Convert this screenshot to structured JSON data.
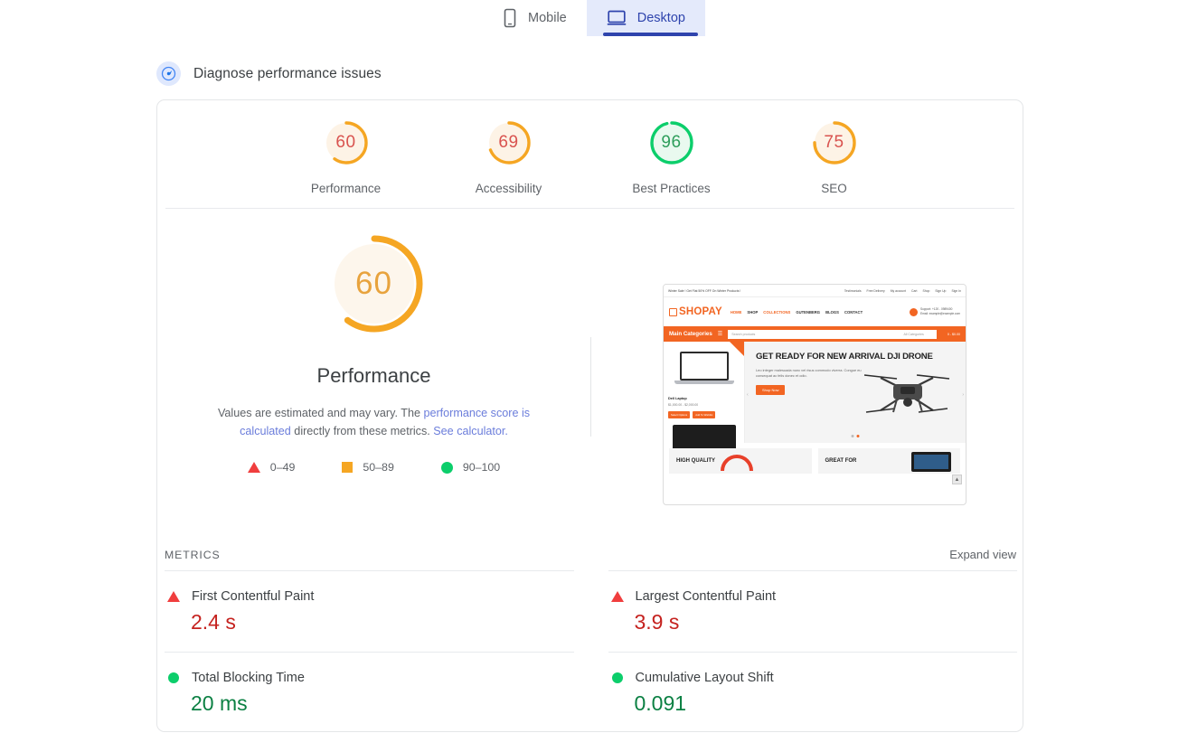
{
  "tabs": [
    {
      "label": "Mobile",
      "icon": "mobile-icon",
      "active": false
    },
    {
      "label": "Desktop",
      "icon": "desktop-icon",
      "active": true
    }
  ],
  "diagnose": {
    "label": "Diagnose performance issues",
    "icon": "speedometer-icon"
  },
  "categories": [
    {
      "label": "Performance",
      "score": 60,
      "color": "#f5a623",
      "fill": "#fef6ec",
      "text": "#d9534f"
    },
    {
      "label": "Accessibility",
      "score": 69,
      "color": "#f5a623",
      "fill": "#fef6ec",
      "text": "#d9534f"
    },
    {
      "label": "Best Practices",
      "score": 96,
      "color": "#0cce6b",
      "fill": "#e9f9ef",
      "text": "#2e9e5b"
    },
    {
      "label": "SEO",
      "score": 75,
      "color": "#f5a623",
      "fill": "#fef6ec",
      "text": "#d9534f"
    }
  ],
  "main_gauge": {
    "score": 60,
    "title": "Performance",
    "color": "#f5a623",
    "fill": "#fdf6ec",
    "desc_pre": "Values are estimated and may vary. The ",
    "desc_link1": "performance score is calculated",
    "desc_mid": " directly from these metrics. ",
    "desc_link2": "See calculator."
  },
  "legend": [
    {
      "shape": "triangle",
      "label": "0–49",
      "color": "#f03e3e"
    },
    {
      "shape": "square",
      "label": "50–89",
      "color": "#f5a623"
    },
    {
      "shape": "circle",
      "label": "90–100",
      "color": "#0cce6b"
    }
  ],
  "metrics_section": {
    "title": "METRICS",
    "expand": "Expand view"
  },
  "metrics": [
    {
      "name": "First Contentful Paint",
      "value": "2.4 s",
      "status": "fail",
      "icon": "warning-triangle-icon"
    },
    {
      "name": "Largest Contentful Paint",
      "value": "3.9 s",
      "status": "fail",
      "icon": "warning-triangle-icon"
    },
    {
      "name": "Total Blocking Time",
      "value": "20 ms",
      "status": "pass",
      "icon": "pass-circle-icon"
    },
    {
      "name": "Cumulative Layout Shift",
      "value": "0.091",
      "status": "pass",
      "icon": "pass-circle-icon"
    }
  ],
  "thumbnail": {
    "topbar_promo": "Winter Sale ! Get Flat 50% OFF On Winter Products !",
    "topbar_links": [
      "Testimonials",
      "Free Delivery",
      "My account",
      "Cart",
      "Shop",
      "Sign Up",
      "Sign In"
    ],
    "brand": "SHOPAY",
    "nav": [
      "HOME",
      "SHOP",
      "COLLECTIONS",
      "GUTENBERG",
      "BLOGS",
      "CONTACT"
    ],
    "support_line1": "Support: +120 - 0989400",
    "support_line2": "Email: example@example.com",
    "main_categories": "Main Categories",
    "search_placeholder": "Search products",
    "category_select": "All Categories",
    "cart_text": "0 - $0.00",
    "product_name": "Dell Laptop",
    "product_price": "$1,000.00 - $2,000.00",
    "product_btn1": "Select Options",
    "product_btn2": "Add To Wishlist",
    "hero_title": "GET READY FOR NEW ARRIVAL DJI DRONE",
    "hero_text": "Leo integer malesuada nunc vel risus commodo viverra. Congue eu consequat ac felis donec et odio.",
    "hero_button": "Shop Now",
    "banner1": "HIGH QUALITY",
    "banner2": "GREAT FOR"
  }
}
